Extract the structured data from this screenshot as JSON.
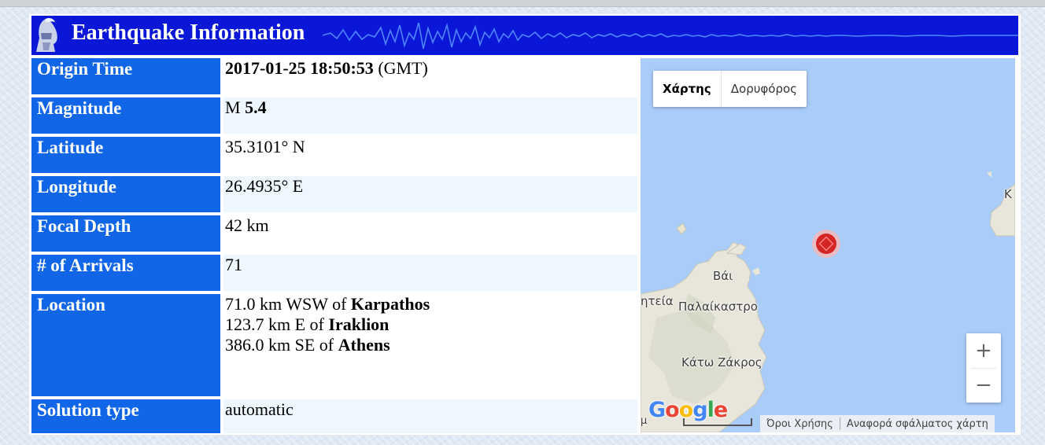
{
  "header": {
    "title": "Earthquake Information",
    "brand_color": "#0a17d6"
  },
  "rows": [
    {
      "label": "Origin Time",
      "value_bold": "2017-01-25 18:50:53",
      "value_suffix": " (GMT)"
    },
    {
      "label": "Magnitude",
      "value_prefix": "M ",
      "value_bold": "5.4"
    },
    {
      "label": "Latitude",
      "value": "35.3101° N"
    },
    {
      "label": "Longitude",
      "value": "26.4935° E"
    },
    {
      "label": "Focal Depth",
      "value": "42 km"
    },
    {
      "label": "# of Arrivals",
      "value": "71"
    },
    {
      "label": "Location",
      "lines": [
        {
          "prefix": "71.0 km WSW of ",
          "bold": "Karpathos"
        },
        {
          "prefix": "123.7 km E of ",
          "bold": "Iraklion"
        },
        {
          "prefix": "386.0 km SE of ",
          "bold": "Athens"
        }
      ]
    },
    {
      "label": "Solution type",
      "value": "automatic"
    }
  ],
  "map": {
    "type_buttons": {
      "map": "Χάρτης",
      "satellite": "Δορυφόρος"
    },
    "zoom_in": "+",
    "zoom_out": "−",
    "places": {
      "vai": "Βάι",
      "palaikastro": "Παλαίκαστρο",
      "partial_west": "ητεία",
      "kato_zakros": "Κάτω Ζάκρος",
      "partial_east": "Κ"
    },
    "logo": "Google",
    "scale_partial": "μ",
    "terms": "Όροι Χρήσης",
    "report": "Αναφορά σφάλματος χάρτη",
    "epicenter_color": "#e02020",
    "sea_color": "#a9ccf8",
    "land_color": "#e8e5da"
  }
}
